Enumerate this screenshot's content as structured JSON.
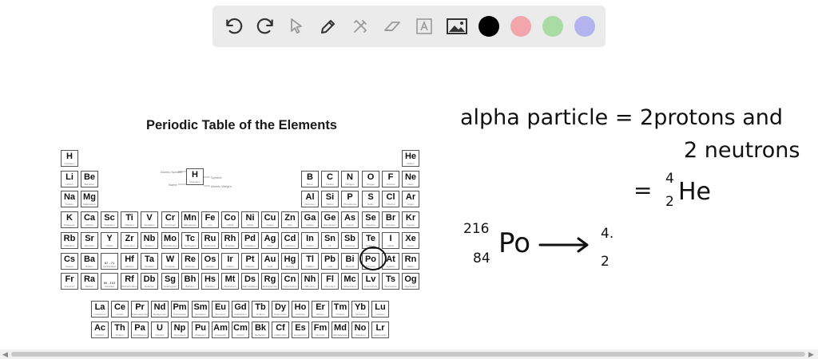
{
  "toolbar": {
    "tools": [
      {
        "name": "undo-icon"
      },
      {
        "name": "redo-icon"
      },
      {
        "name": "select-icon"
      },
      {
        "name": "pen-icon"
      },
      {
        "name": "tools-icon"
      },
      {
        "name": "eraser-icon"
      },
      {
        "name": "text-icon"
      },
      {
        "name": "image-icon"
      }
    ],
    "colors": [
      "#000000",
      "#f2a5ab",
      "#a9dba4",
      "#b3b3ee"
    ]
  },
  "periodic_table": {
    "title": "Periodic Table of the Elements",
    "main_rows": [
      [
        [
          "H",
          "Hydrogen"
        ],
        null,
        null,
        null,
        null,
        null,
        null,
        null,
        null,
        null,
        null,
        null,
        null,
        null,
        null,
        null,
        null,
        [
          "He",
          "Helium"
        ]
      ],
      [
        [
          "Li",
          "Lithium"
        ],
        [
          "Be",
          "Beryllium"
        ],
        null,
        null,
        null,
        null,
        null,
        null,
        null,
        null,
        null,
        null,
        [
          "B",
          "Boron"
        ],
        [
          "C",
          "Carbon"
        ],
        [
          "N",
          "Nitrogen"
        ],
        [
          "O",
          "Oxygen"
        ],
        [
          "F",
          "Fluorine"
        ],
        [
          "Ne",
          "Neon"
        ]
      ],
      [
        [
          "Na",
          "Sodium"
        ],
        [
          "Mg",
          "Magnesium"
        ],
        null,
        null,
        null,
        null,
        null,
        null,
        null,
        null,
        null,
        null,
        [
          "Al",
          "Aluminum"
        ],
        [
          "Si",
          "Silicon"
        ],
        [
          "P",
          "Phosphorus"
        ],
        [
          "S",
          "Sulfur"
        ],
        [
          "Cl",
          "Chlorine"
        ],
        [
          "Ar",
          "Argon"
        ]
      ],
      [
        [
          "K",
          "Potassium"
        ],
        [
          "Ca",
          "Calcium"
        ],
        [
          "Sc",
          "Scandium"
        ],
        [
          "Ti",
          "Titanium"
        ],
        [
          "V",
          "Vanadium"
        ],
        [
          "Cr",
          "Chromium"
        ],
        [
          "Mn",
          "Manganese"
        ],
        [
          "Fe",
          "Iron"
        ],
        [
          "Co",
          "Cobalt"
        ],
        [
          "Ni",
          "Nickel"
        ],
        [
          "Cu",
          "Copper"
        ],
        [
          "Zn",
          "Zinc"
        ],
        [
          "Ga",
          "Gallium"
        ],
        [
          "Ge",
          "Germanium"
        ],
        [
          "As",
          "Arsenic"
        ],
        [
          "Se",
          "Selenium"
        ],
        [
          "Br",
          "Bromine"
        ],
        [
          "Kr",
          "Krypton"
        ]
      ],
      [
        [
          "Rb",
          "Rubidium"
        ],
        [
          "Sr",
          "Strontium"
        ],
        [
          "Y",
          "Yttrium"
        ],
        [
          "Zr",
          "Zirconium"
        ],
        [
          "Nb",
          "Niobium"
        ],
        [
          "Mo",
          "Molybdenum"
        ],
        [
          "Tc",
          "Technetium"
        ],
        [
          "Ru",
          "Ruthenium"
        ],
        [
          "Rh",
          "Rhodium"
        ],
        [
          "Pd",
          "Palladium"
        ],
        [
          "Ag",
          "Silver"
        ],
        [
          "Cd",
          "Cadmium"
        ],
        [
          "In",
          "Indium"
        ],
        [
          "Sn",
          "Tin"
        ],
        [
          "Sb",
          "Antimony"
        ],
        [
          "Te",
          "Tellurium"
        ],
        [
          "I",
          "Iodine"
        ],
        [
          "Xe",
          "Xenon"
        ]
      ],
      [
        [
          "Cs",
          "Cesium"
        ],
        [
          "Ba",
          "Barium"
        ],
        [
          "57 - 71",
          "Lanthanides"
        ],
        [
          "Hf",
          "Hafnium"
        ],
        [
          "Ta",
          "Tantalum"
        ],
        [
          "W",
          "Tungsten"
        ],
        [
          "Re",
          "Rhenium"
        ],
        [
          "Os",
          "Osmium"
        ],
        [
          "Ir",
          "Iridium"
        ],
        [
          "Pt",
          "Platinum"
        ],
        [
          "Au",
          "Gold"
        ],
        [
          "Hg",
          "Mercury"
        ],
        [
          "Tl",
          "Thallium"
        ],
        [
          "Pb",
          "Lead"
        ],
        [
          "Bi",
          "Bismuth"
        ],
        [
          "Po",
          "Polonium"
        ],
        [
          "At",
          "Astatine"
        ],
        [
          "Rn",
          "Radon"
        ]
      ],
      [
        [
          "Fr",
          "Francium"
        ],
        [
          "Ra",
          "Radium"
        ],
        [
          "89 - 103",
          "Actinides"
        ],
        [
          "Rf",
          "Rutherfordium"
        ],
        [
          "Db",
          "Dubnium"
        ],
        [
          "Sg",
          "Seaborgium"
        ],
        [
          "Bh",
          "Bohrium"
        ],
        [
          "Hs",
          "Hassium"
        ],
        [
          "Mt",
          "Meitnerium"
        ],
        [
          "Ds",
          "Darmstadtium"
        ],
        [
          "Rg",
          "Roentgenium"
        ],
        [
          "Cn",
          "Copernicium"
        ],
        [
          "Nh",
          "Nihonium"
        ],
        [
          "Fl",
          "Flerovium"
        ],
        [
          "Mc",
          "Moscovium"
        ],
        [
          "Lv",
          "Livermorium"
        ],
        [
          "Ts",
          "Tennessine"
        ],
        [
          "Og",
          "Oganesson"
        ]
      ]
    ],
    "lanthanides": [
      [
        "La",
        "Lanthanum"
      ],
      [
        "Ce",
        "Cerium"
      ],
      [
        "Pr",
        "Praseodymium"
      ],
      [
        "Nd",
        "Neodymium"
      ],
      [
        "Pm",
        "Promethium"
      ],
      [
        "Sm",
        "Samarium"
      ],
      [
        "Eu",
        "Europium"
      ],
      [
        "Gd",
        "Gadolinium"
      ],
      [
        "Tb",
        "Terbium"
      ],
      [
        "Dy",
        "Dysprosium"
      ],
      [
        "Ho",
        "Holmium"
      ],
      [
        "Er",
        "Erbium"
      ],
      [
        "Tm",
        "Thulium"
      ],
      [
        "Yb",
        "Ytterbium"
      ],
      [
        "Lu",
        "Lutetium"
      ]
    ],
    "actinides": [
      [
        "Ac",
        "Actinium"
      ],
      [
        "Th",
        "Thorium"
      ],
      [
        "Pa",
        "Protactinium"
      ],
      [
        "U",
        "Uranium"
      ],
      [
        "Np",
        "Neptunium"
      ],
      [
        "Pu",
        "Plutonium"
      ],
      [
        "Am",
        "Americium"
      ],
      [
        "Cm",
        "Curium"
      ],
      [
        "Bk",
        "Berkelium"
      ],
      [
        "Cf",
        "Californium"
      ],
      [
        "Es",
        "Einsteinium"
      ],
      [
        "Fm",
        "Fermium"
      ],
      [
        "Md",
        "Mendelevium"
      ],
      [
        "No",
        "Nobelium"
      ],
      [
        "Lr",
        "Lawrencium"
      ]
    ],
    "legend": {
      "symbol": "H",
      "name": "Hydrogen",
      "labels": [
        "Atomic Number",
        "Name",
        "Symbol",
        "Atomic Weight"
      ]
    },
    "circled_element": "Po"
  },
  "handwriting": {
    "line1": "alpha particle = 2protons and",
    "line2": "2 neutrons",
    "he_equals": "=",
    "he_mass": "4",
    "he_atomic": "2",
    "he_symbol": "He",
    "po_mass": "216",
    "po_atomic": "84",
    "po_symbol": "Po",
    "product_mass": "4.",
    "product_atomic": "2"
  }
}
